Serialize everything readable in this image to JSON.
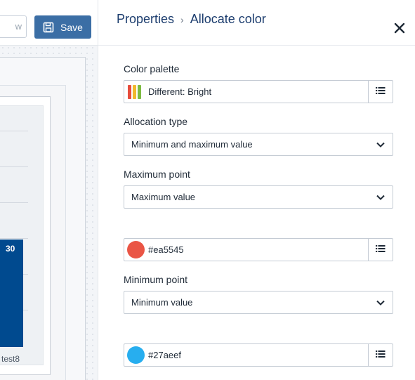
{
  "toolbar": {
    "preview_label": "w",
    "save_label": "Save"
  },
  "chart_preview": {
    "bar_value": "30",
    "category_label": "test8",
    "bar_color": "#004a8f"
  },
  "panel": {
    "breadcrumb": {
      "parent": "Properties",
      "separator": "›",
      "current": "Allocate color"
    },
    "color_palette": {
      "label": "Color palette",
      "value": "Different: Bright",
      "swatch_colors": [
        "#e74c3c",
        "#f1b82d",
        "#7dbb42"
      ]
    },
    "allocation_type": {
      "label": "Allocation type",
      "value": "Minimum and maximum value"
    },
    "maximum_point": {
      "label": "Maximum point",
      "value": "Maximum value",
      "color": "#ea5545"
    },
    "minimum_point": {
      "label": "Minimum point",
      "value": "Minimum value",
      "color": "#27aeef"
    }
  },
  "colors": {
    "accent": "#3b6ea5",
    "title": "#1c3d6e"
  },
  "icons": {
    "save": "floppy-disk-icon",
    "close": "close-icon",
    "list": "list-icon",
    "chevron": "chevron-down-icon"
  }
}
